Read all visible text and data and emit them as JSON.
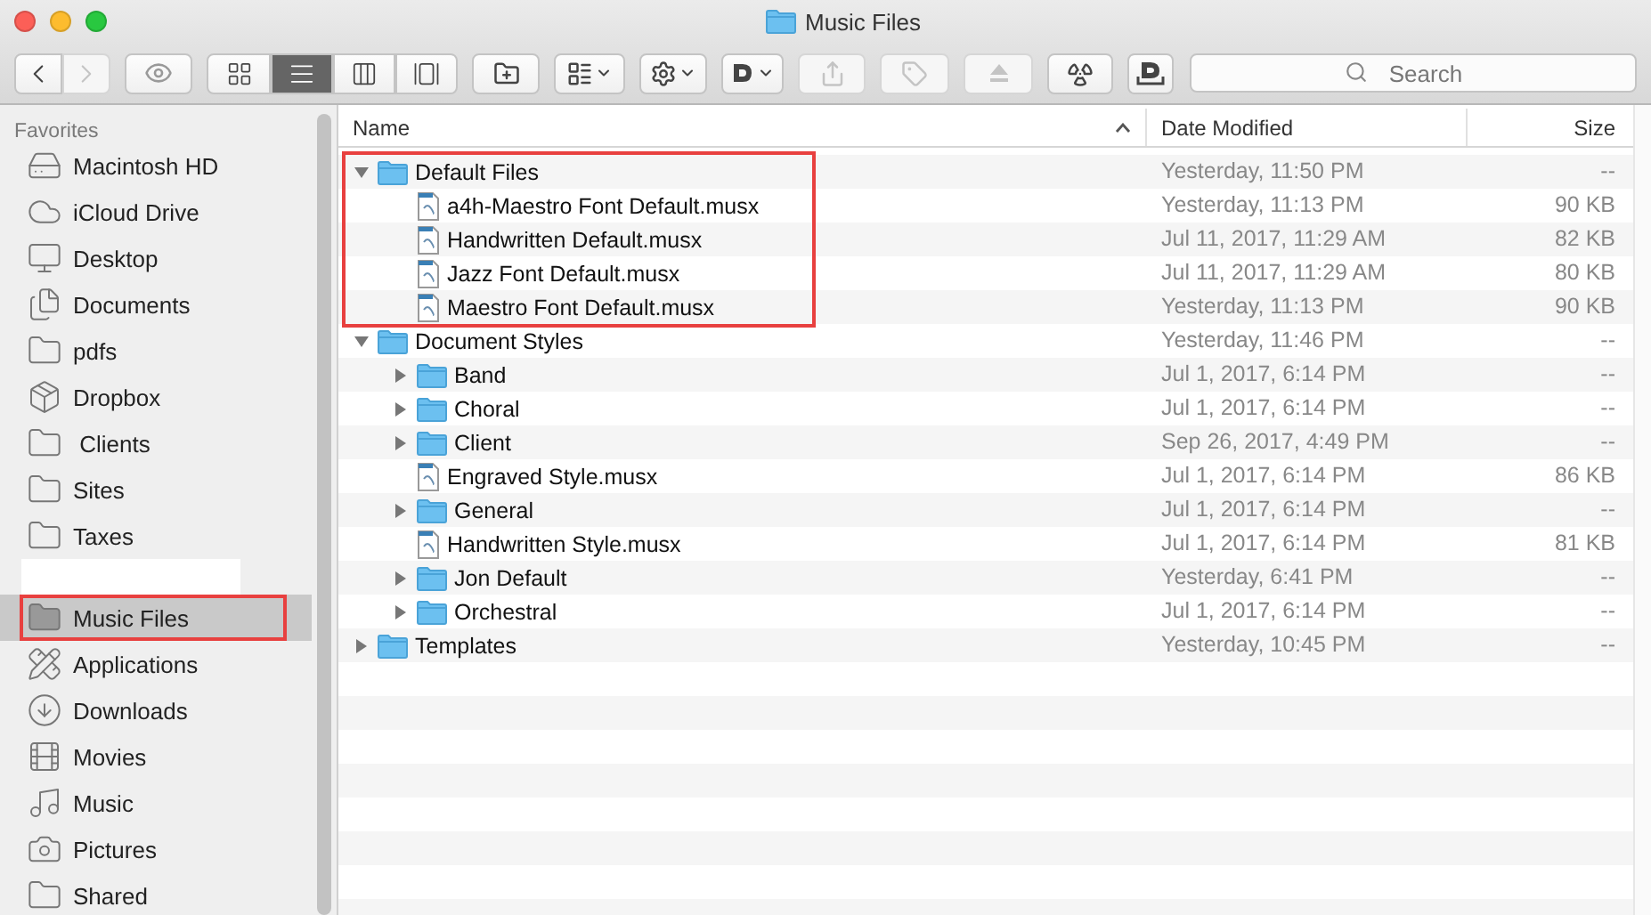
{
  "window": {
    "title": "Music Files"
  },
  "toolbar": {
    "nav": [
      {
        "kind": "back",
        "disabled": false
      },
      {
        "kind": "forward",
        "disabled": true
      }
    ],
    "view_modes": [
      {
        "kind": "icons",
        "selected": false
      },
      {
        "kind": "list",
        "selected": true
      },
      {
        "kind": "columns",
        "selected": false
      },
      {
        "kind": "gallery",
        "selected": false
      }
    ],
    "buttons": [
      {
        "kind": "new-folder",
        "disabled": false
      },
      {
        "kind": "arrange",
        "disabled": false
      },
      {
        "kind": "action",
        "disabled": false
      },
      {
        "kind": "d-menu",
        "disabled": false
      },
      {
        "kind": "share",
        "disabled": true
      },
      {
        "kind": "tag",
        "disabled": true
      },
      {
        "kind": "eject",
        "disabled": true
      },
      {
        "kind": "radiation",
        "disabled": false
      },
      {
        "kind": "d-box",
        "disabled": false
      }
    ],
    "search": {
      "placeholder": "Search"
    }
  },
  "sidebar": {
    "heading": "Favorites",
    "sections": [
      {
        "items": [
          {
            "label": "Macintosh HD",
            "kind": "disk",
            "selected": false
          },
          {
            "label": "iCloud Drive",
            "kind": "cloud",
            "selected": false
          },
          {
            "label": "Desktop",
            "kind": "desktop",
            "selected": false
          },
          {
            "label": "Documents",
            "kind": "documents",
            "selected": false
          },
          {
            "label": "pdfs",
            "kind": "folder",
            "selected": false
          },
          {
            "label": "Dropbox",
            "kind": "dropbox",
            "selected": false
          },
          {
            "label": " Clients",
            "kind": "folder",
            "selected": false
          },
          {
            "label": "Sites",
            "kind": "folder",
            "selected": false
          },
          {
            "label": "Taxes",
            "kind": "folder",
            "selected": false
          }
        ]
      },
      {
        "items": [
          {
            "label": "Music Files",
            "kind": "folder",
            "selected": true,
            "highlighted": true
          },
          {
            "label": "Applications",
            "kind": "apps",
            "selected": false
          },
          {
            "label": "Downloads",
            "kind": "downloads",
            "selected": false
          },
          {
            "label": "Movies",
            "kind": "movies",
            "selected": false
          },
          {
            "label": "Music",
            "kind": "music",
            "selected": false
          },
          {
            "label": "Pictures",
            "kind": "pictures",
            "selected": false
          },
          {
            "label": "Shared",
            "kind": "folder",
            "selected": false
          }
        ]
      }
    ]
  },
  "file_list": {
    "columns": [
      {
        "label": "Name",
        "sorted": true
      },
      {
        "label": "Date Modified",
        "sorted": false
      },
      {
        "label": "Size",
        "sorted": false
      }
    ],
    "rows": [
      {
        "name": "Default Files",
        "kind": "folder",
        "expanded": true,
        "highlighted": true,
        "date": "Yesterday, 11:50 PM",
        "size": "--",
        "children": [
          {
            "name": "a4h-Maestro Font Default.musx",
            "kind": "file",
            "date": "Yesterday, 11:13 PM",
            "size": "90 KB"
          },
          {
            "name": "Handwritten Default.musx",
            "kind": "file",
            "date": "Jul 11, 2017, 11:29 AM",
            "size": "82 KB"
          },
          {
            "name": "Jazz Font Default.musx",
            "kind": "file",
            "date": "Jul 11, 2017, 11:29 AM",
            "size": "80 KB"
          },
          {
            "name": "Maestro Font Default.musx",
            "kind": "file",
            "date": "Yesterday, 11:13 PM",
            "size": "90 KB"
          }
        ]
      },
      {
        "name": "Document Styles",
        "kind": "folder",
        "expanded": true,
        "date": "Yesterday, 11:46 PM",
        "size": "--",
        "children": [
          {
            "name": "Band",
            "kind": "folder",
            "expanded": false,
            "date": "Jul 1, 2017, 6:14 PM",
            "size": "--"
          },
          {
            "name": "Choral",
            "kind": "folder",
            "expanded": false,
            "date": "Jul 1, 2017, 6:14 PM",
            "size": "--"
          },
          {
            "name": "Client",
            "kind": "folder",
            "expanded": false,
            "date": "Sep 26, 2017, 4:49 PM",
            "size": "--"
          },
          {
            "name": "Engraved Style.musx",
            "kind": "file",
            "date": "Jul 1, 2017, 6:14 PM",
            "size": "86 KB"
          },
          {
            "name": "General",
            "kind": "folder",
            "expanded": false,
            "date": "Jul 1, 2017, 6:14 PM",
            "size": "--"
          },
          {
            "name": "Handwritten Style.musx",
            "kind": "file",
            "date": "Jul 1, 2017, 6:14 PM",
            "size": "81 KB"
          },
          {
            "name": "Jon Default",
            "kind": "folder",
            "expanded": false,
            "date": "Yesterday, 6:41 PM",
            "size": "--"
          },
          {
            "name": "Orchestral",
            "kind": "folder",
            "expanded": false,
            "date": "Jul 1, 2017, 6:14 PM",
            "size": "--"
          }
        ]
      },
      {
        "name": "Templates",
        "kind": "folder",
        "expanded": false,
        "date": "Yesterday, 10:45 PM",
        "size": "--"
      }
    ]
  }
}
